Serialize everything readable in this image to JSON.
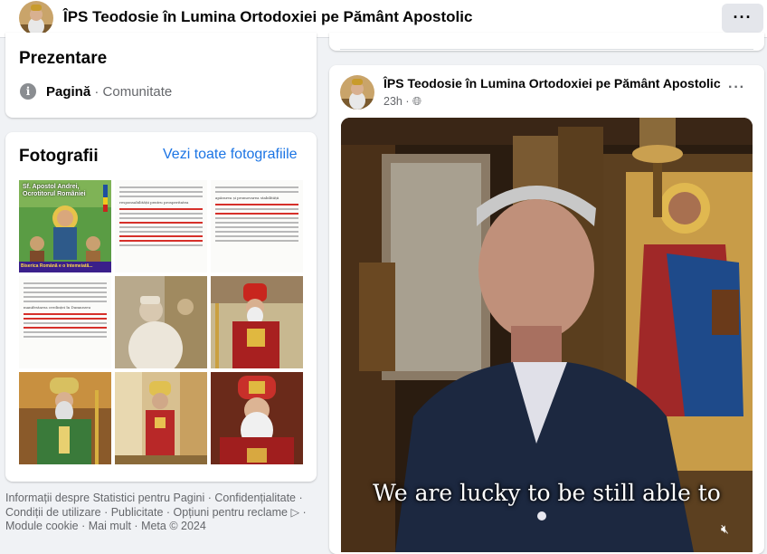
{
  "page": {
    "title": "ÎPS Teodosie în Lumina Ortodoxiei pe Pământ Apostolic",
    "more_label": "···"
  },
  "intro": {
    "heading": "Prezentare",
    "category_type": "Pagină",
    "category_sep": " · ",
    "category_value": "Comunitate"
  },
  "photos": {
    "heading": "Fotografii",
    "see_all": "Vezi toate fotografiile",
    "items": [
      {
        "name": "photo-icon-saint-andrew",
        "caption": "Sf. Apostol Andrei, Ocrotitorul României",
        "subcaption": "Biserica Română e o întemeiată..."
      },
      {
        "name": "photo-document-1",
        "caption": "responsabilității pentru prosperitatea"
      },
      {
        "name": "photo-document-2",
        "caption": "apărarea și promovarea stabilității"
      },
      {
        "name": "photo-document-3",
        "caption": "manifestarea credinței în Dumnezeu"
      },
      {
        "name": "photo-bishop-blessing"
      },
      {
        "name": "photo-bishop-vestments"
      },
      {
        "name": "photo-bishop-green-vestments"
      },
      {
        "name": "photo-church-interior"
      },
      {
        "name": "photo-bishop-portrait"
      }
    ]
  },
  "footer": {
    "links": [
      "Informații despre Statistici pentru Pagini",
      "Confidențialitate",
      "Condiții de utilizare",
      "Publicitate",
      "Opțiuni pentru reclame",
      "Module cookie",
      "Mai mult",
      "Meta © 2024"
    ]
  },
  "post": {
    "author": "ÎPS Teodosie în Lumina Ortodoxiei pe Pământ Apostolic",
    "time": "23h",
    "menu_label": "···",
    "video_caption": "We are lucky to be still able to"
  },
  "colors": {
    "link": "#1b74e4",
    "secondary_text": "#65676b",
    "background": "#f0f2f5"
  }
}
